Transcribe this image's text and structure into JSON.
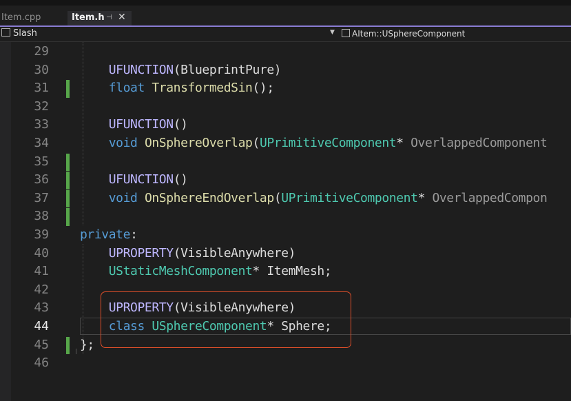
{
  "tabs": [
    {
      "label": "Item.cpp",
      "active": false
    },
    {
      "label": "Item.h",
      "active": true
    }
  ],
  "tab_icons": {
    "pin": "pin-icon",
    "close": "close-icon"
  },
  "nav": {
    "project": "Slash",
    "scope": "AItem::USphereComponent"
  },
  "colors": {
    "keyword": "#569cd6",
    "macro": "#beb7ff",
    "function": "#dcdcaa",
    "type": "#4ec9b0",
    "changed_marker": "#57a64a",
    "highlight_box": "#e04f2a",
    "accent": "#8a7cd4"
  },
  "active_line": 44,
  "lines": [
    {
      "n": "29",
      "tokens": []
    },
    {
      "n": "30",
      "tokens": [
        [
          "    ",
          ""
        ],
        [
          "UFUNCTION",
          "mac"
        ],
        [
          "(BlueprintPure)",
          ""
        ]
      ]
    },
    {
      "n": "31",
      "tokens": [
        [
          "    ",
          ""
        ],
        [
          "float",
          "kw"
        ],
        [
          " ",
          ""
        ],
        [
          "TransformedSin",
          "fn"
        ],
        [
          "();",
          ""
        ]
      ],
      "changed": true
    },
    {
      "n": "32",
      "tokens": []
    },
    {
      "n": "33",
      "tokens": [
        [
          "    ",
          ""
        ],
        [
          "UFUNCTION",
          "mac"
        ],
        [
          "()",
          ""
        ]
      ]
    },
    {
      "n": "34",
      "tokens": [
        [
          "    ",
          ""
        ],
        [
          "void",
          "kw"
        ],
        [
          " ",
          ""
        ],
        [
          "OnSphereOverlap",
          "fn"
        ],
        [
          "(",
          ""
        ],
        [
          "UPrimitiveComponent",
          "ty"
        ],
        [
          "* ",
          ""
        ],
        [
          "OverlappedComponent",
          "pm"
        ]
      ]
    },
    {
      "n": "35",
      "tokens": [],
      "changed": true
    },
    {
      "n": "36",
      "tokens": [
        [
          "    ",
          ""
        ],
        [
          "UFUNCTION",
          "mac"
        ],
        [
          "()",
          ""
        ]
      ],
      "changed": true
    },
    {
      "n": "37",
      "tokens": [
        [
          "    ",
          ""
        ],
        [
          "void",
          "kw"
        ],
        [
          " ",
          ""
        ],
        [
          "OnSphereEndOverlap",
          "fn"
        ],
        [
          "(",
          ""
        ],
        [
          "UPrimitiveComponent",
          "ty"
        ],
        [
          "* ",
          ""
        ],
        [
          "OverlappedCompon",
          "pm"
        ]
      ],
      "changed": true
    },
    {
      "n": "38",
      "tokens": [],
      "changed": true
    },
    {
      "n": "39",
      "tokens": [
        [
          "private",
          "kw"
        ],
        [
          ":",
          ""
        ]
      ]
    },
    {
      "n": "40",
      "tokens": [
        [
          "    ",
          ""
        ],
        [
          "UPROPERTY",
          "mac"
        ],
        [
          "(VisibleAnywhere)",
          ""
        ]
      ]
    },
    {
      "n": "41",
      "tokens": [
        [
          "    ",
          ""
        ],
        [
          "UStaticMeshComponent",
          "ty"
        ],
        [
          "* ItemMesh;",
          ""
        ]
      ]
    },
    {
      "n": "42",
      "tokens": []
    },
    {
      "n": "43",
      "tokens": [
        [
          "    ",
          ""
        ],
        [
          "UPROPERTY",
          "mac"
        ],
        [
          "(VisibleAnywhere)",
          ""
        ]
      ]
    },
    {
      "n": "44",
      "tokens": [
        [
          "    ",
          ""
        ],
        [
          "class",
          "kw"
        ],
        [
          " ",
          ""
        ],
        [
          "USphereComponent",
          "ty"
        ],
        [
          "* Sphere;",
          ""
        ]
      ]
    },
    {
      "n": "45",
      "tokens": [
        [
          "};",
          ""
        ]
      ],
      "changed": true
    },
    {
      "n": "46",
      "tokens": []
    }
  ]
}
